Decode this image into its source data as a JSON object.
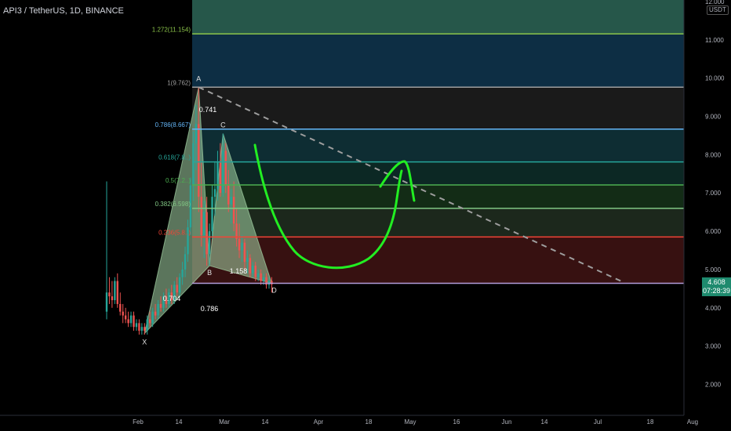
{
  "header": {
    "ticker": "API3 / TetherUS, 1D, BINANCE"
  },
  "price_axis": {
    "unit_badge": "USDT",
    "ticks": [
      "12.000",
      "11.000",
      "10.000",
      "9.000",
      "8.000",
      "7.000",
      "6.000",
      "5.000",
      "4.000",
      "3.000",
      "2.000"
    ],
    "current_price": "4.608",
    "countdown": "07:28:39"
  },
  "time_axis": {
    "labels": [
      "Feb",
      "14",
      "Mar",
      "14",
      "Apr",
      "18",
      "May",
      "16",
      "Jun",
      "14",
      "Jul",
      "18",
      "Aug"
    ]
  },
  "colors": {
    "background": "#000000",
    "up_candle": "#26a69a",
    "down_candle": "#ef5350",
    "harmonic_fill": "#a5d6a7",
    "hand_drawn_arrow": "#22ee22",
    "trendline": "#9e9e9e"
  },
  "chart_data": {
    "type": "candlestick",
    "title": "API3 / TetherUS, 1D, BINANCE",
    "ylim": [
      1.5,
      12.2
    ],
    "y_ticks": [
      12,
      11,
      10,
      9,
      8,
      7,
      6,
      5,
      4,
      3,
      2
    ],
    "fib_levels": [
      {
        "label": "1.272(11.154)",
        "ratio": 1.272,
        "price": 11.154,
        "line_color": "#8bc34a",
        "band_color": "#26574a"
      },
      {
        "label": "1(9.762)",
        "ratio": 1,
        "price": 9.762,
        "line_color": "#9e9e9e",
        "band_color": "#0e3048"
      },
      {
        "label": "0.786(8.667)",
        "ratio": 0.786,
        "price": 8.667,
        "line_color": "#64b5f6",
        "band_color": "#1b1b1b"
      },
      {
        "label": "0.618(7.8..)",
        "ratio": 0.618,
        "price": 7.81,
        "line_color": "#26a69a",
        "band_color": "#0f2f36"
      },
      {
        "label": "0.5(7.2..)",
        "ratio": 0.5,
        "price": 7.21,
        "line_color": "#4caf50",
        "band_color": "#0d2a26"
      },
      {
        "label": "0.382(6.598)",
        "ratio": 0.382,
        "price": 6.598,
        "line_color": "#81c784",
        "band_color": "#142e17"
      },
      {
        "label": "0.236(5.8..)",
        "ratio": 0.236,
        "price": 5.85,
        "line_color": "#f44336",
        "band_color": "#1e2a1e"
      },
      {
        "label": "",
        "ratio": 0,
        "price": 4.64,
        "line_color": "#b39ddb",
        "band_color": "#3a1212"
      }
    ],
    "harmonic_points": [
      {
        "label": "X",
        "date_index": 14,
        "price": 3.33
      },
      {
        "label": "A",
        "date_index": 34,
        "price": 9.762
      },
      {
        "label": "B",
        "date_index": 38,
        "price": 5.1
      },
      {
        "label": "C",
        "date_index": 43,
        "price": 8.55
      },
      {
        "label": "D",
        "date_index": 61,
        "price": 4.64
      }
    ],
    "harmonic_ratios": [
      {
        "label": "0.741",
        "leg": "AC"
      },
      {
        "label": "1.158",
        "leg": "BD"
      },
      {
        "label": "0.704",
        "leg": "XB"
      },
      {
        "label": "0.786",
        "leg": "XD"
      }
    ],
    "trendline": {
      "from": {
        "date_index": 34,
        "price": 9.762
      },
      "to": {
        "date_index": 190,
        "price": 4.7
      }
    },
    "candles": [
      [
        3.9,
        7.3,
        3.7,
        4.4
      ],
      [
        4.4,
        4.8,
        4.1,
        4.3
      ],
      [
        4.3,
        4.7,
        4.0,
        4.2
      ],
      [
        4.2,
        4.8,
        4.1,
        4.7
      ],
      [
        4.7,
        4.9,
        4.0,
        4.1
      ],
      [
        4.1,
        4.4,
        3.8,
        3.9
      ],
      [
        3.9,
        4.1,
        3.6,
        3.8
      ],
      [
        3.8,
        4.0,
        3.6,
        3.7
      ],
      [
        3.7,
        3.9,
        3.5,
        3.6
      ],
      [
        3.6,
        3.9,
        3.5,
        3.8
      ],
      [
        3.8,
        3.9,
        3.4,
        3.5
      ],
      [
        3.5,
        3.7,
        3.4,
        3.6
      ],
      [
        3.6,
        3.7,
        3.3,
        3.4
      ],
      [
        3.4,
        3.6,
        3.3,
        3.5
      ],
      [
        3.5,
        3.6,
        3.3,
        3.4
      ],
      [
        3.4,
        3.8,
        3.3,
        3.7
      ],
      [
        3.7,
        3.9,
        3.5,
        3.6
      ],
      [
        3.6,
        4.0,
        3.5,
        3.9
      ],
      [
        3.9,
        4.1,
        3.7,
        3.8
      ],
      [
        3.8,
        4.2,
        3.7,
        4.1
      ],
      [
        4.1,
        4.3,
        3.9,
        4.0
      ],
      [
        4.0,
        4.4,
        3.9,
        4.3
      ],
      [
        4.3,
        4.5,
        4.0,
        4.1
      ],
      [
        4.1,
        4.5,
        4.0,
        4.4
      ],
      [
        4.4,
        4.6,
        4.1,
        4.2
      ],
      [
        4.2,
        4.7,
        4.1,
        4.6
      ],
      [
        4.6,
        4.8,
        4.3,
        4.4
      ],
      [
        4.4,
        4.9,
        4.3,
        4.8
      ],
      [
        4.8,
        5.2,
        4.6,
        5.0
      ],
      [
        5.0,
        5.6,
        4.8,
        5.4
      ],
      [
        5.4,
        6.3,
        5.2,
        6.1
      ],
      [
        6.1,
        7.4,
        5.9,
        7.2
      ],
      [
        7.2,
        8.6,
        6.8,
        8.3
      ],
      [
        8.3,
        9.3,
        7.6,
        8.8
      ],
      [
        8.8,
        9.76,
        6.5,
        6.9
      ],
      [
        6.9,
        7.8,
        5.6,
        5.9
      ],
      [
        5.9,
        6.8,
        5.3,
        6.5
      ],
      [
        6.5,
        6.9,
        5.1,
        5.4
      ],
      [
        5.4,
        6.2,
        5.1,
        6.0
      ],
      [
        6.0,
        7.2,
        5.8,
        6.9
      ],
      [
        6.9,
        7.8,
        6.4,
        7.1
      ],
      [
        7.1,
        8.1,
        6.8,
        7.8
      ],
      [
        7.8,
        8.3,
        6.9,
        7.0
      ],
      [
        7.0,
        8.55,
        6.9,
        8.1
      ],
      [
        8.1,
        8.3,
        7.0,
        7.2
      ],
      [
        7.2,
        7.6,
        6.5,
        6.7
      ],
      [
        6.7,
        7.1,
        6.2,
        6.9
      ],
      [
        6.9,
        7.3,
        6.0,
        6.2
      ],
      [
        6.2,
        6.6,
        5.6,
        5.8
      ],
      [
        5.8,
        6.2,
        5.3,
        5.5
      ],
      [
        5.5,
        5.9,
        5.2,
        5.7
      ],
      [
        5.7,
        5.8,
        5.0,
        5.2
      ],
      [
        5.2,
        5.5,
        4.9,
        5.3
      ],
      [
        5.3,
        5.4,
        4.8,
        4.9
      ],
      [
        4.9,
        5.2,
        4.8,
        5.1
      ],
      [
        5.1,
        5.2,
        4.7,
        4.8
      ],
      [
        4.8,
        5.0,
        4.7,
        4.9
      ],
      [
        4.9,
        5.0,
        4.6,
        4.7
      ],
      [
        4.7,
        4.9,
        4.6,
        4.8
      ],
      [
        4.8,
        4.9,
        4.5,
        4.6
      ],
      [
        4.6,
        4.8,
        4.5,
        4.7
      ],
      [
        4.7,
        4.8,
        4.4,
        4.61
      ]
    ],
    "legend": "none",
    "grid": false
  }
}
